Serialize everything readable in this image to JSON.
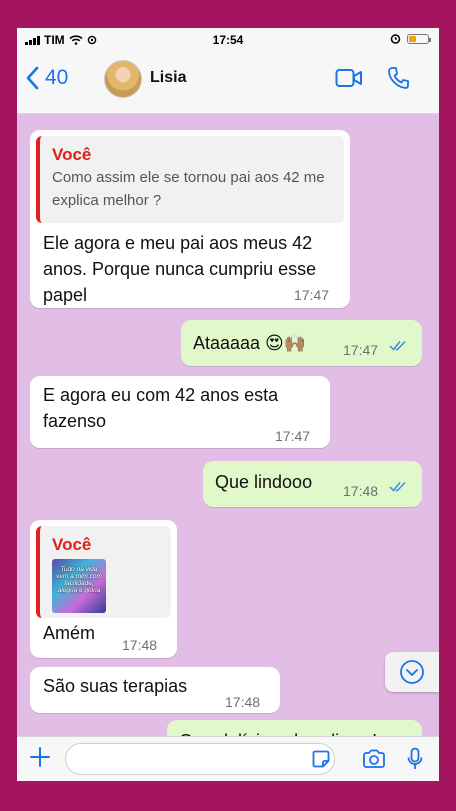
{
  "status_bar": {
    "carrier": "TIM",
    "time": "17:54"
  },
  "header": {
    "back_count": "40",
    "contact_name": "Lisia"
  },
  "messages": [
    {
      "direction": "in",
      "quote": {
        "author": "Você",
        "text": "Como assim ele se tornou pai aos 42 me explica melhor ?"
      },
      "text": "Ele agora e meu pai aos meus 42 anos. Porque nunca cumpriu esse papel",
      "time": "17:47"
    },
    {
      "direction": "out",
      "text": "Ataaaaa 😍🙌🏽",
      "time": "17:47",
      "read": true
    },
    {
      "direction": "in",
      "text": "E agora eu com 42 anos esta fazenso",
      "time": "17:47"
    },
    {
      "direction": "out",
      "text": "Que lindooo",
      "time": "17:48",
      "read": true
    },
    {
      "direction": "in",
      "quote": {
        "author": "Você",
        "image_text": "Tudo na vida vem a mim com facilidade, alegria e glória"
      },
      "text": "Amém",
      "time": "17:48"
    },
    {
      "direction": "in",
      "text": "São suas terapias",
      "time": "17:48"
    },
    {
      "direction": "out",
      "text": "Que delícia saber disso !"
    }
  ],
  "input": {
    "placeholder": ""
  },
  "colors": {
    "accent": "#1a73e8",
    "quote_author": "#e0201b",
    "chat_bg": "#e2bde6",
    "outgoing_bubble": "#e1f8cb",
    "frame": "#a3155f"
  }
}
